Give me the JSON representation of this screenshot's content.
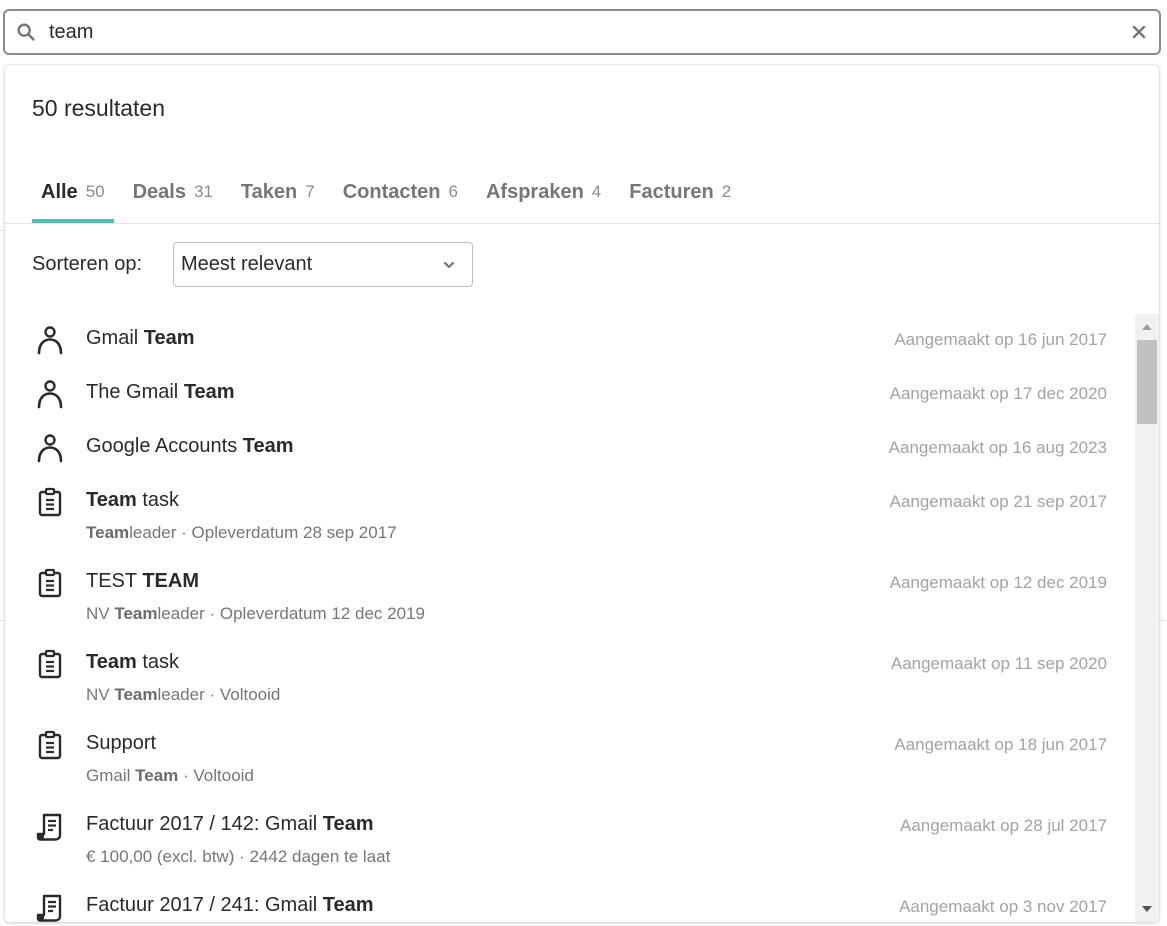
{
  "search": {
    "query": "team"
  },
  "results_header": {
    "count_label": "50 resultaten"
  },
  "tabs": [
    {
      "label": "Alle",
      "count": "50",
      "active": true
    },
    {
      "label": "Deals",
      "count": "31",
      "active": false
    },
    {
      "label": "Taken",
      "count": "7",
      "active": false
    },
    {
      "label": "Contacten",
      "count": "6",
      "active": false
    },
    {
      "label": "Afspraken",
      "count": "4",
      "active": false
    },
    {
      "label": "Facturen",
      "count": "2",
      "active": false
    }
  ],
  "sort": {
    "label": "Sorteren op:",
    "selected": "Meest relevant"
  },
  "colors": {
    "accent": "#4fbdb6",
    "muted_text": "#a2a2a8"
  },
  "results": [
    {
      "icon": "person-icon",
      "title_parts": [
        {
          "text": "Gmail ",
          "bold": false
        },
        {
          "text": "Team",
          "bold": true
        }
      ],
      "subtitle_parts": [],
      "date": "Aangemaakt op 16 jun 2017"
    },
    {
      "icon": "person-icon",
      "title_parts": [
        {
          "text": "The Gmail ",
          "bold": false
        },
        {
          "text": "Team",
          "bold": true
        }
      ],
      "subtitle_parts": [],
      "date": "Aangemaakt op 17 dec 2020"
    },
    {
      "icon": "person-icon",
      "title_parts": [
        {
          "text": "Google Accounts ",
          "bold": false
        },
        {
          "text": "Team",
          "bold": true
        }
      ],
      "subtitle_parts": [],
      "date": "Aangemaakt op 16 aug 2023"
    },
    {
      "icon": "clipboard-icon",
      "title_parts": [
        {
          "text": "Team",
          "bold": true
        },
        {
          "text": " task",
          "bold": false
        }
      ],
      "subtitle_parts": [
        {
          "text": "Team",
          "bold": true
        },
        {
          "text": "leader · Opleverdatum 28 sep 2017",
          "bold": false
        }
      ],
      "date": "Aangemaakt op 21 sep 2017"
    },
    {
      "icon": "clipboard-icon",
      "title_parts": [
        {
          "text": "TEST ",
          "bold": false
        },
        {
          "text": "TEAM",
          "bold": true
        }
      ],
      "subtitle_parts": [
        {
          "text": "NV ",
          "bold": false
        },
        {
          "text": "Team",
          "bold": true
        },
        {
          "text": "leader · Opleverdatum 12 dec 2019",
          "bold": false
        }
      ],
      "date": "Aangemaakt op 12 dec 2019"
    },
    {
      "icon": "clipboard-icon",
      "title_parts": [
        {
          "text": "Team",
          "bold": true
        },
        {
          "text": " task",
          "bold": false
        }
      ],
      "subtitle_parts": [
        {
          "text": "NV ",
          "bold": false
        },
        {
          "text": "Team",
          "bold": true
        },
        {
          "text": "leader · Voltooid",
          "bold": false
        }
      ],
      "date": "Aangemaakt op 11 sep 2020"
    },
    {
      "icon": "clipboard-icon",
      "title_parts": [
        {
          "text": "Support",
          "bold": false
        }
      ],
      "subtitle_parts": [
        {
          "text": "Gmail ",
          "bold": false
        },
        {
          "text": "Team",
          "bold": true
        },
        {
          "text": " · Voltooid",
          "bold": false
        }
      ],
      "date": "Aangemaakt op 18 jun 2017"
    },
    {
      "icon": "invoice-icon",
      "title_parts": [
        {
          "text": "Factuur 2017 / 142: Gmail ",
          "bold": false
        },
        {
          "text": "Team",
          "bold": true
        }
      ],
      "subtitle_parts": [
        {
          "text": "€ 100,00 (excl. btw) · 2442 dagen te laat",
          "bold": false
        }
      ],
      "date": "Aangemaakt op 28 jul 2017"
    },
    {
      "icon": "invoice-icon",
      "title_parts": [
        {
          "text": "Factuur 2017 / 241: Gmail ",
          "bold": false
        },
        {
          "text": "Team",
          "bold": true
        }
      ],
      "subtitle_parts": [],
      "date": "Aangemaakt op 3 nov 2017"
    }
  ]
}
